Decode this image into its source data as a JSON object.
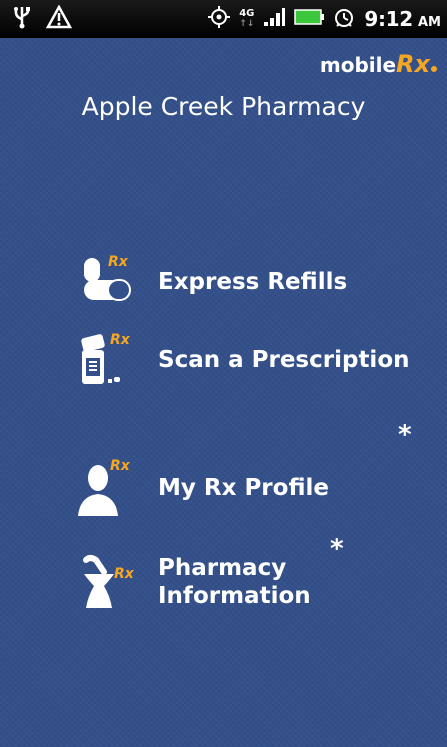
{
  "status_bar": {
    "network": "4G",
    "time": "9:12",
    "ampm": "AM"
  },
  "brand": {
    "prefix": "mobile",
    "suffix": "Rx"
  },
  "pharmacy_name": "Apple Creek Pharmacy",
  "menu": {
    "rx_tag": "Rx",
    "items": [
      {
        "label": "Express Refills",
        "icon": "pill-capsule-icon"
      },
      {
        "label": "Scan a Prescription",
        "icon": "pill-bottle-scan-icon"
      },
      {
        "label": "My Rx Profile",
        "icon": "person-silhouette-icon"
      },
      {
        "label": "Pharmacy\nInformation",
        "icon": "mortar-pestle-icon"
      }
    ]
  },
  "asterisk": "*",
  "colors": {
    "background": "#34508a",
    "accent": "#f5a623",
    "status_bar": "#000000",
    "battery": "#3cc63c"
  }
}
